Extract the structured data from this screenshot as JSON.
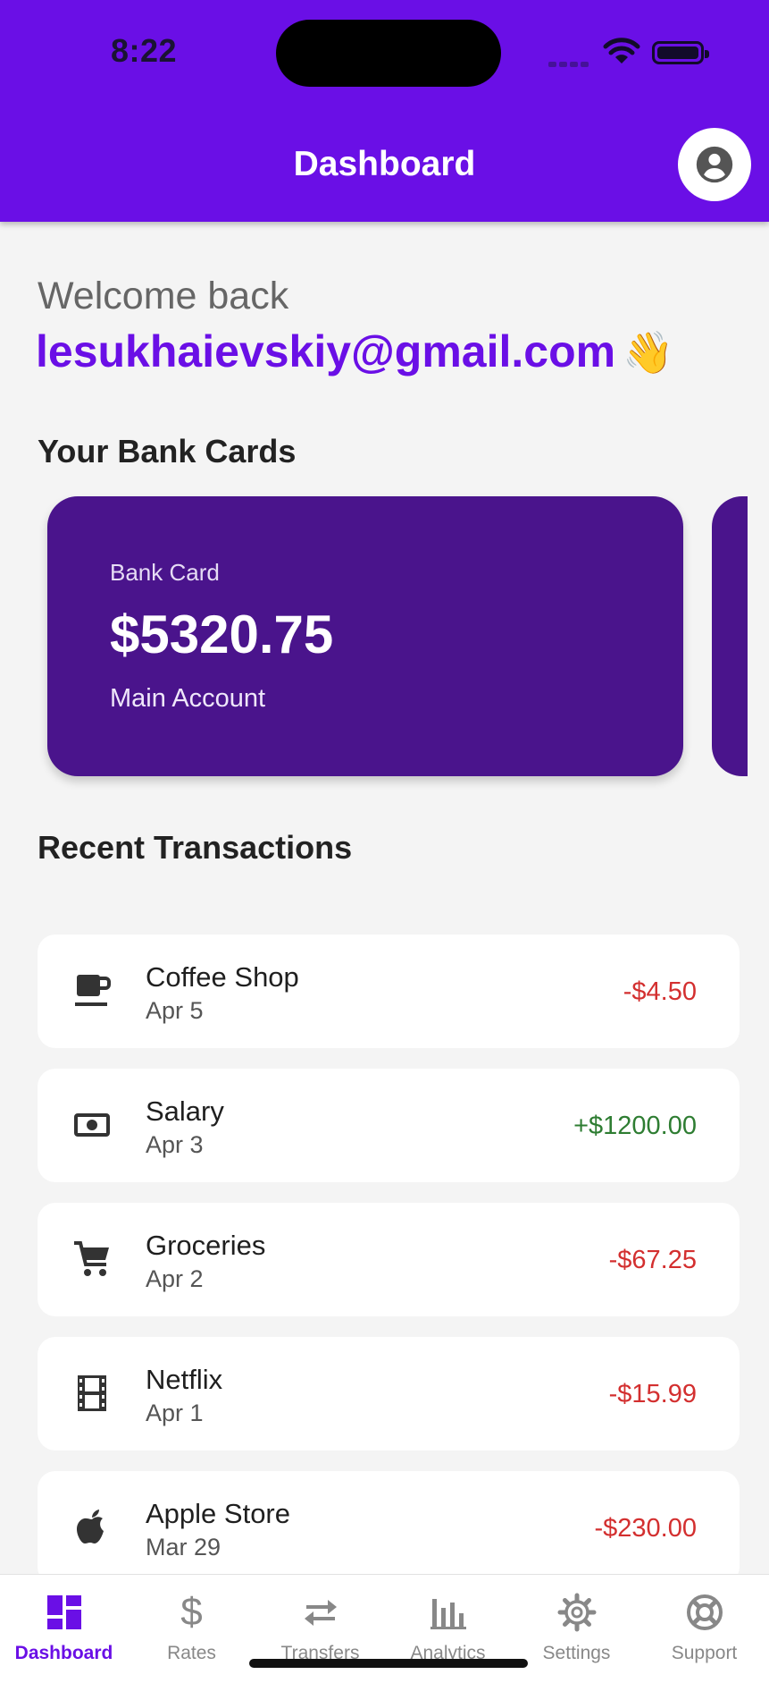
{
  "status_bar": {
    "time": "8:22"
  },
  "header": {
    "title": "Dashboard",
    "profile_icon": "account-circle-icon"
  },
  "welcome": {
    "greeting": "Welcome back",
    "email": "lesukhaievskiy@gmail.com",
    "emoji": "👋"
  },
  "cards_section": {
    "title": "Your Bank Cards",
    "cards": [
      {
        "label": "Bank Card",
        "balance": "$5320.75",
        "account": "Main Account"
      }
    ]
  },
  "transactions_section": {
    "title": "Recent Transactions",
    "items": [
      {
        "name": "Coffee Shop",
        "date": "Apr 5",
        "amount": "-$4.50",
        "icon": "coffee-icon",
        "type": "debit"
      },
      {
        "name": "Salary",
        "date": "Apr 3",
        "amount": "+$1200.00",
        "icon": "money-icon",
        "type": "credit"
      },
      {
        "name": "Groceries",
        "date": "Apr 2",
        "amount": "-$67.25",
        "icon": "cart-icon",
        "type": "debit"
      },
      {
        "name": "Netflix",
        "date": "Apr 1",
        "amount": "-$15.99",
        "icon": "film-icon",
        "type": "debit"
      },
      {
        "name": "Apple Store",
        "date": "Mar 29",
        "amount": "-$230.00",
        "icon": "apple-icon",
        "type": "debit"
      }
    ]
  },
  "bottom_nav": {
    "items": [
      {
        "label": "Dashboard",
        "icon": "dashboard-icon",
        "active": true
      },
      {
        "label": "Rates",
        "icon": "dollar-icon",
        "active": false
      },
      {
        "label": "Transfers",
        "icon": "swap-icon",
        "active": false
      },
      {
        "label": "Analytics",
        "icon": "bar-chart-icon",
        "active": false
      },
      {
        "label": "Settings",
        "icon": "gear-icon",
        "active": false
      },
      {
        "label": "Support",
        "icon": "lifebuoy-icon",
        "active": false
      }
    ]
  },
  "colors": {
    "primary": "#6a0fe6",
    "card": "#4a148c",
    "debit": "#d32f2f",
    "credit": "#2e7d32",
    "background": "#f4f4f4"
  }
}
